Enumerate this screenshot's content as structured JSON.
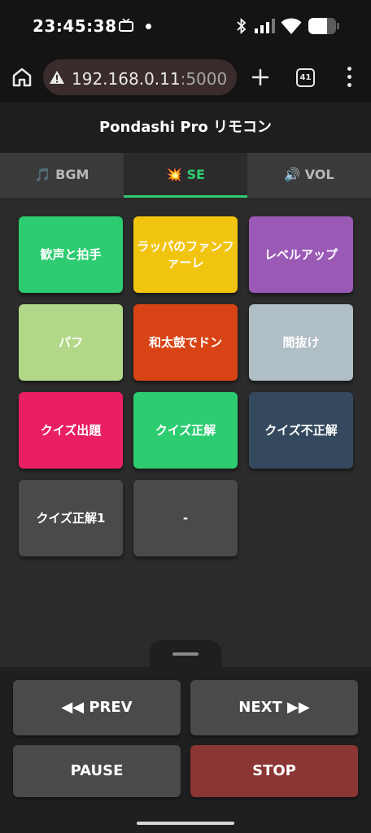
{
  "status_bar": {
    "time": "23:45:38",
    "icons": [
      "tv-icon",
      "notification-dot",
      "bluetooth-icon",
      "signal-icon",
      "wifi-icon",
      "battery-icon"
    ]
  },
  "browser": {
    "url_host": "192.168.0.11",
    "url_port": ":5000",
    "tab_count": "41",
    "icons": [
      "home-icon",
      "warning-icon",
      "plus-icon",
      "tabs-icon",
      "menu-icon"
    ]
  },
  "app": {
    "title": "Pondashi Pro リモコン",
    "tabs": [
      {
        "emoji": "🎵",
        "label": "BGM",
        "active": false
      },
      {
        "emoji": "💥",
        "label": "SE",
        "active": true
      },
      {
        "emoji": "🔊",
        "label": "VOL",
        "active": false
      }
    ],
    "se_buttons": [
      {
        "label": "歓声と拍手",
        "color": "#2ecc71"
      },
      {
        "label": "ラッパのファンファーレ",
        "color": "#f1c40f"
      },
      {
        "label": "レベルアップ",
        "color": "#9b59b6"
      },
      {
        "label": "パフ",
        "color": "#b0d888"
      },
      {
        "label": "和太鼓でドン",
        "color": "#d84315"
      },
      {
        "label": "間抜け",
        "color": "#b0bec5"
      },
      {
        "label": "クイズ出題",
        "color": "#e91e63"
      },
      {
        "label": "クイズ正解",
        "color": "#2ecc71"
      },
      {
        "label": "クイズ不正解",
        "color": "#34495e"
      },
      {
        "label": "クイズ正解1",
        "color": "#4a4a4a"
      },
      {
        "label": "-",
        "color": "#4a4a4a"
      }
    ],
    "controls": {
      "prev": "◀◀ PREV",
      "next": "NEXT ▶▶",
      "pause": "PAUSE",
      "stop": "STOP"
    },
    "colors": {
      "accent": "#2ecc71",
      "stop": "#8b3535",
      "control": "#4a4a4a"
    }
  }
}
